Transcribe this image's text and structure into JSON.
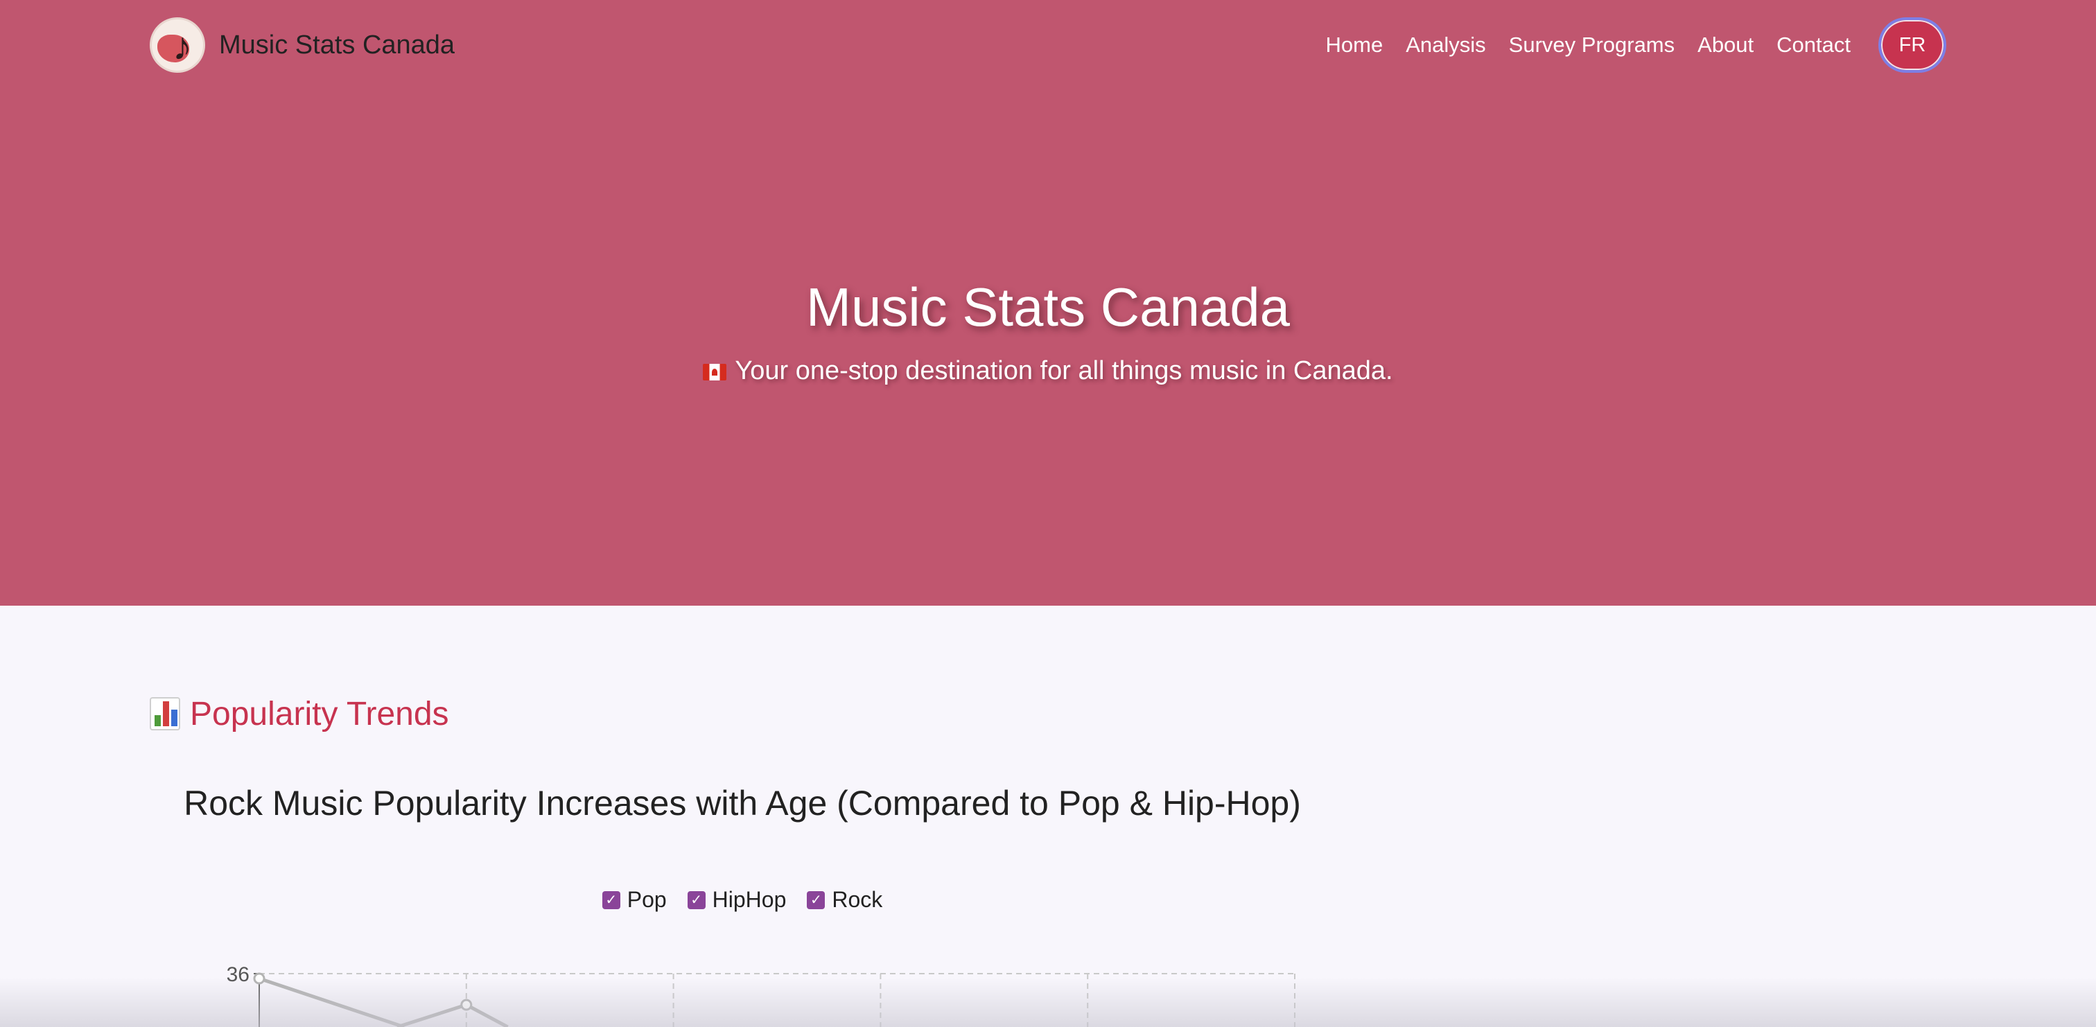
{
  "navbar": {
    "brand": "Music Stats Canada",
    "logo": "maple-leaf-music-note-logo",
    "links": [
      "Home",
      "Analysis",
      "Survey Programs",
      "About",
      "Contact"
    ],
    "language_button": "FR"
  },
  "hero": {
    "title": "Music Stats Canada",
    "subtitle": "Your one-stop destination for all things music in Canada.",
    "subtitle_icon": "canada-flag-icon",
    "background_color": "#c0566f"
  },
  "section": {
    "title": "Popularity Trends",
    "icon": "bar-chart-icon",
    "accent_color": "#c7334f"
  },
  "chart_data": {
    "type": "line",
    "title": "Rock Music Popularity Increases with Age (Compared to Pop & Hip-Hop)",
    "legend": [
      "Pop",
      "HipHop",
      "Rock"
    ],
    "legend_placement": "top-center",
    "y_tick_visible": [
      "36"
    ],
    "grid": true,
    "series_visible": [
      {
        "values_partial": [
          35,
          32
        ]
      }
    ]
  }
}
